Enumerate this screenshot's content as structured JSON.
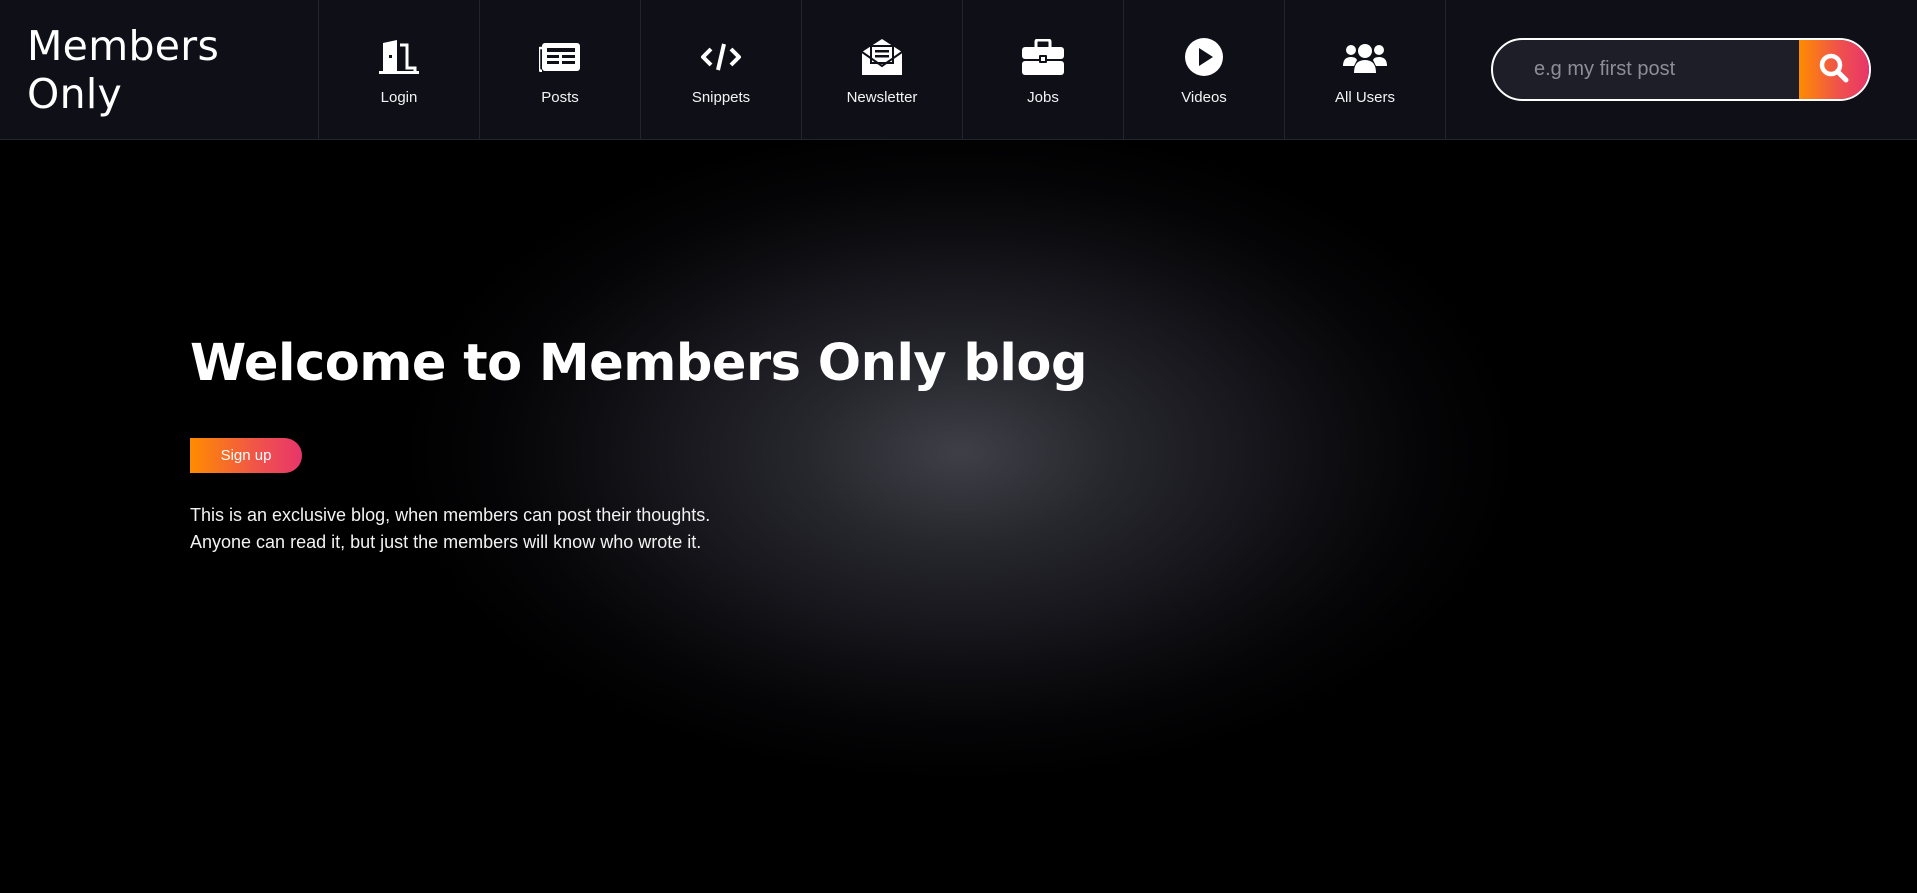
{
  "header": {
    "brand": "Members Only",
    "nav": [
      {
        "label": "Login",
        "icon": "door-icon"
      },
      {
        "label": "Posts",
        "icon": "newspaper-icon"
      },
      {
        "label": "Snippets",
        "icon": "code-icon"
      },
      {
        "label": "Newsletter",
        "icon": "envelope-open-icon"
      },
      {
        "label": "Jobs",
        "icon": "briefcase-icon"
      },
      {
        "label": "Videos",
        "icon": "play-circle-icon"
      },
      {
        "label": "All Users",
        "icon": "users-icon"
      }
    ],
    "search": {
      "placeholder": "e.g my first post",
      "value": "",
      "button_icon": "search-icon"
    }
  },
  "hero": {
    "title": "Welcome to Members Only blog",
    "signup_label": "Sign up",
    "description_lines": [
      "This is an exclusive blog, when members can post their thoughts.",
      "Anyone can read it, but just the members will know who wrote it."
    ]
  },
  "colors": {
    "header_bg": "#0f0f18",
    "accent_start": "#ff8c00",
    "accent_end": "#e8356b",
    "page_bg": "#000000"
  }
}
